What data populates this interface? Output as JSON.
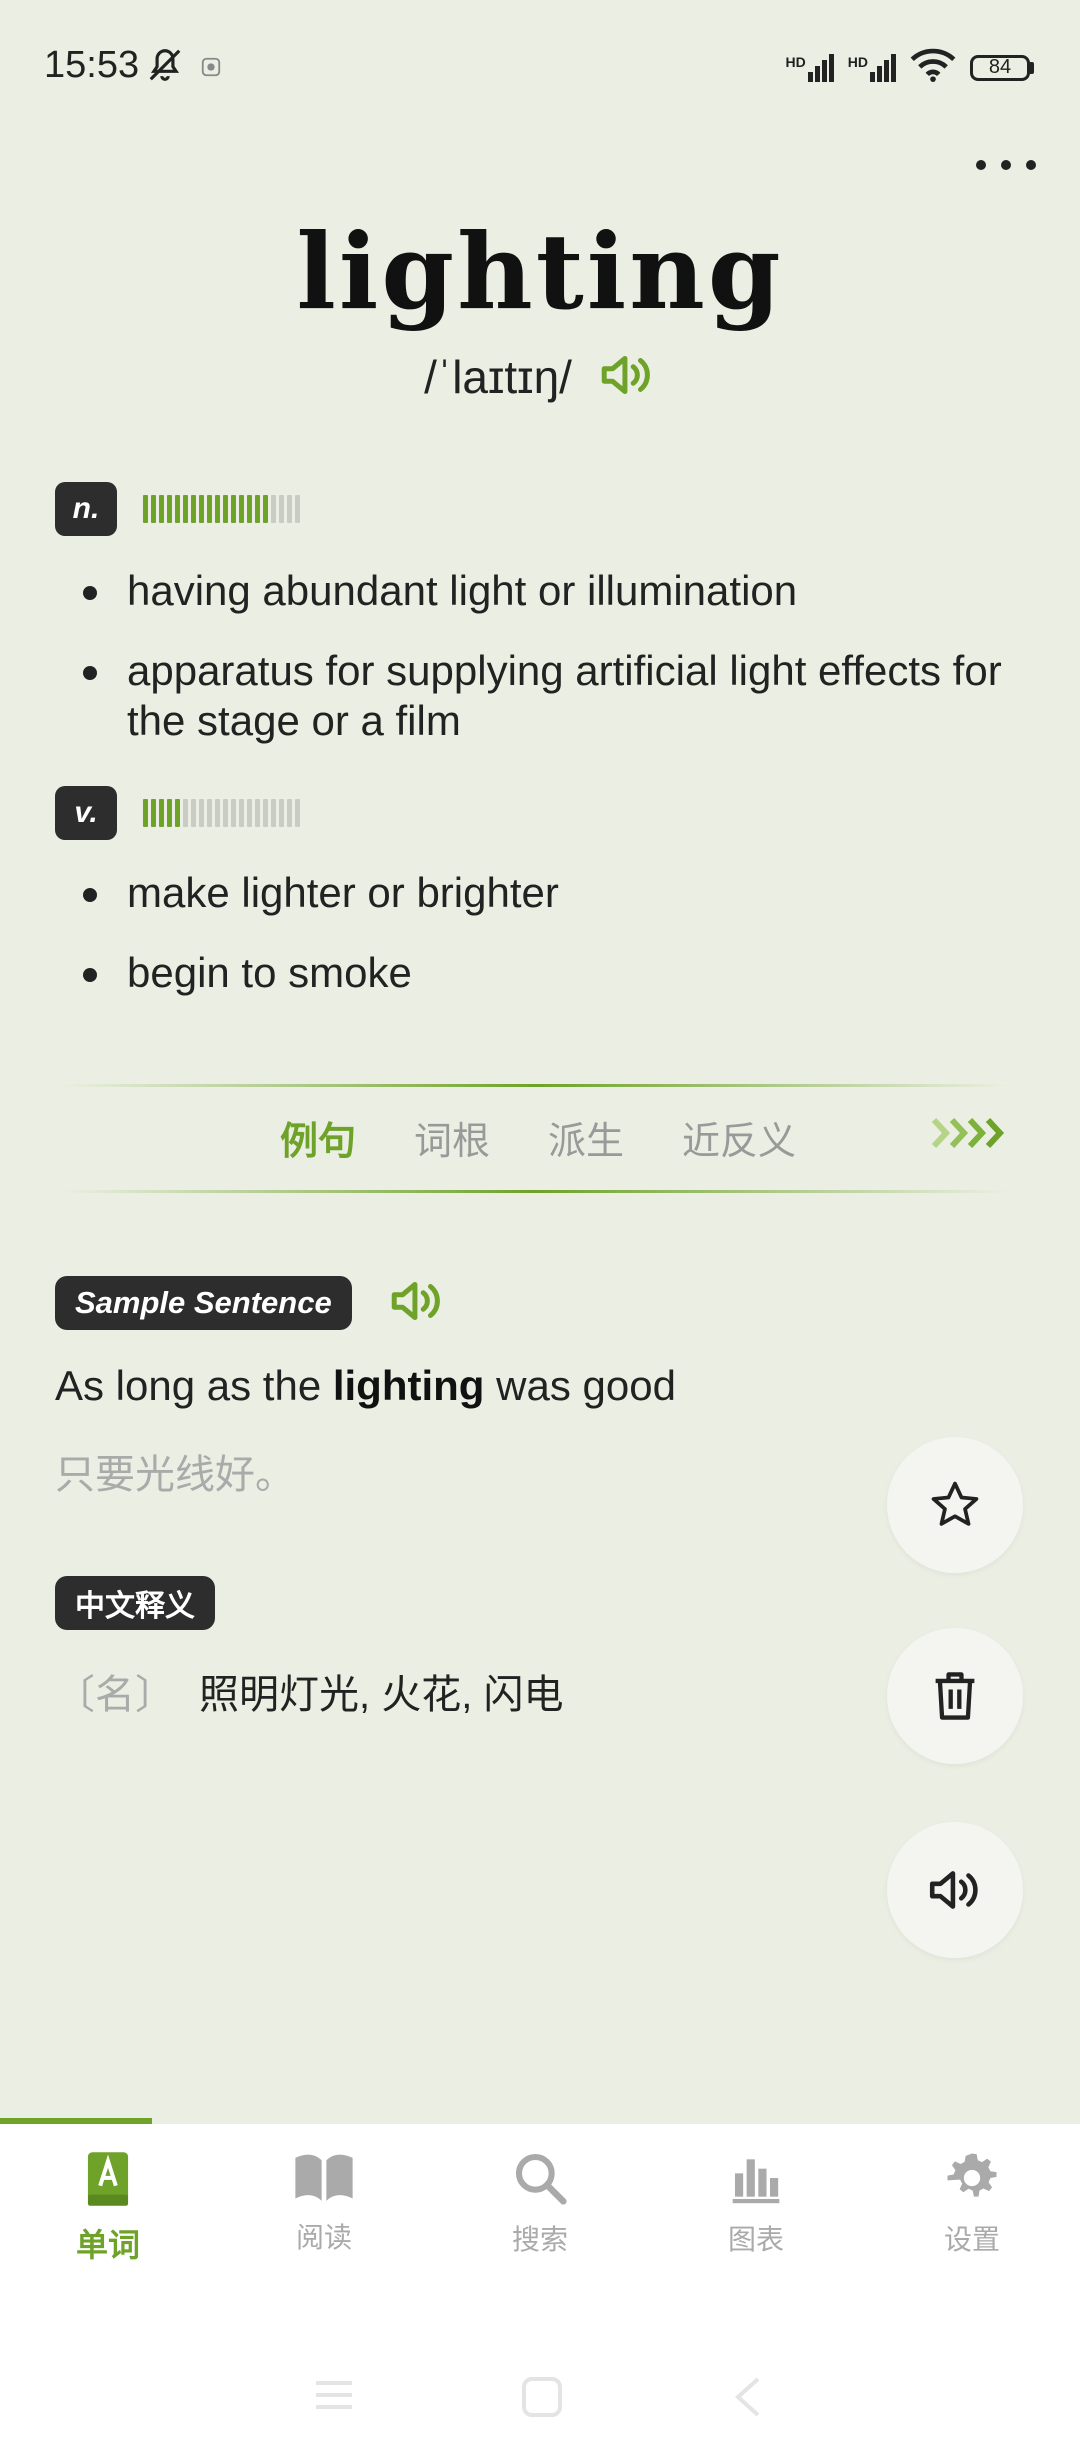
{
  "status_bar": {
    "time": "15:53",
    "battery": "84",
    "network": "HD"
  },
  "word": "lighting",
  "phonetic": "/ˈlaɪtɪŋ/",
  "senses": [
    {
      "pos": "n.",
      "frequency": 0.8,
      "definitions": [
        "having abundant light or illumination",
        "apparatus for supplying artificial light effects for the stage or a film"
      ]
    },
    {
      "pos": "v.",
      "frequency": 0.25,
      "definitions": [
        "make lighter or brighter",
        "begin to smoke"
      ]
    }
  ],
  "tabs": [
    "例句",
    "词根",
    "派生",
    "近反义"
  ],
  "sample": {
    "label": "Sample Sentence",
    "before": "As long as the ",
    "highlight": "lighting",
    "after": " was good",
    "translation": "只要光线好。"
  },
  "chinese": {
    "label": "中文释义",
    "pos": "〔名〕",
    "meaning": "照明灯光, 火花, 闪电"
  },
  "nav": [
    "单词",
    "阅读",
    "搜索",
    "图表",
    "设置"
  ],
  "colors": {
    "accent": "#6ea229",
    "background": "#ebefe3"
  }
}
